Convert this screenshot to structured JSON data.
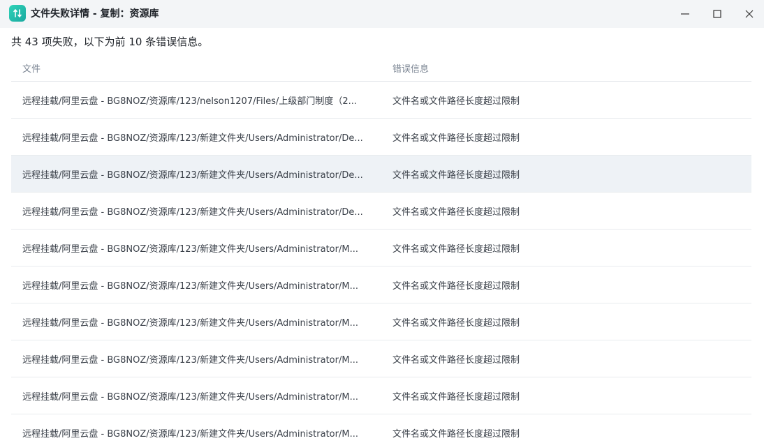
{
  "window": {
    "title": "文件失败详情 - 复制：资源库",
    "icon": "transfer-app-icon",
    "controls": [
      "minimize-icon",
      "maximize-icon",
      "close-icon"
    ]
  },
  "summary": {
    "text": "共 43 项失败，以下为前 10 条错误信息。"
  },
  "table": {
    "headers": {
      "file": "文件",
      "error": "错误信息"
    },
    "rows": [
      {
        "file": "远程挂载/阿里云盘 - BG8NOZ/资源库/123/nelson1207/Files/上级部门制度（2...",
        "error": "文件名或文件路径长度超过限制"
      },
      {
        "file": "远程挂载/阿里云盘 - BG8NOZ/资源库/123/新建文件夹/Users/Administrator/De...",
        "error": "文件名或文件路径长度超过限制"
      },
      {
        "file": "远程挂载/阿里云盘 - BG8NOZ/资源库/123/新建文件夹/Users/Administrator/De...",
        "error": "文件名或文件路径长度超过限制"
      },
      {
        "file": "远程挂载/阿里云盘 - BG8NOZ/资源库/123/新建文件夹/Users/Administrator/De...",
        "error": "文件名或文件路径长度超过限制"
      },
      {
        "file": "远程挂载/阿里云盘 - BG8NOZ/资源库/123/新建文件夹/Users/Administrator/M...",
        "error": "文件名或文件路径长度超过限制"
      },
      {
        "file": "远程挂载/阿里云盘 - BG8NOZ/资源库/123/新建文件夹/Users/Administrator/M...",
        "error": "文件名或文件路径长度超过限制"
      },
      {
        "file": "远程挂载/阿里云盘 - BG8NOZ/资源库/123/新建文件夹/Users/Administrator/M...",
        "error": "文件名或文件路径长度超过限制"
      },
      {
        "file": "远程挂载/阿里云盘 - BG8NOZ/资源库/123/新建文件夹/Users/Administrator/M...",
        "error": "文件名或文件路径长度超过限制"
      },
      {
        "file": "远程挂载/阿里云盘 - BG8NOZ/资源库/123/新建文件夹/Users/Administrator/M...",
        "error": "文件名或文件路径长度超过限制"
      },
      {
        "file": "远程挂载/阿里云盘 - BG8NOZ/资源库/123/新建文件夹/Users/Administrator/M...",
        "error": "文件名或文件路径长度超过限制"
      }
    ]
  },
  "colors": {
    "accent": "#1aa9a0",
    "titlebar_bg": "#f3f5f7",
    "row_hover_bg": "#eef2f6"
  }
}
